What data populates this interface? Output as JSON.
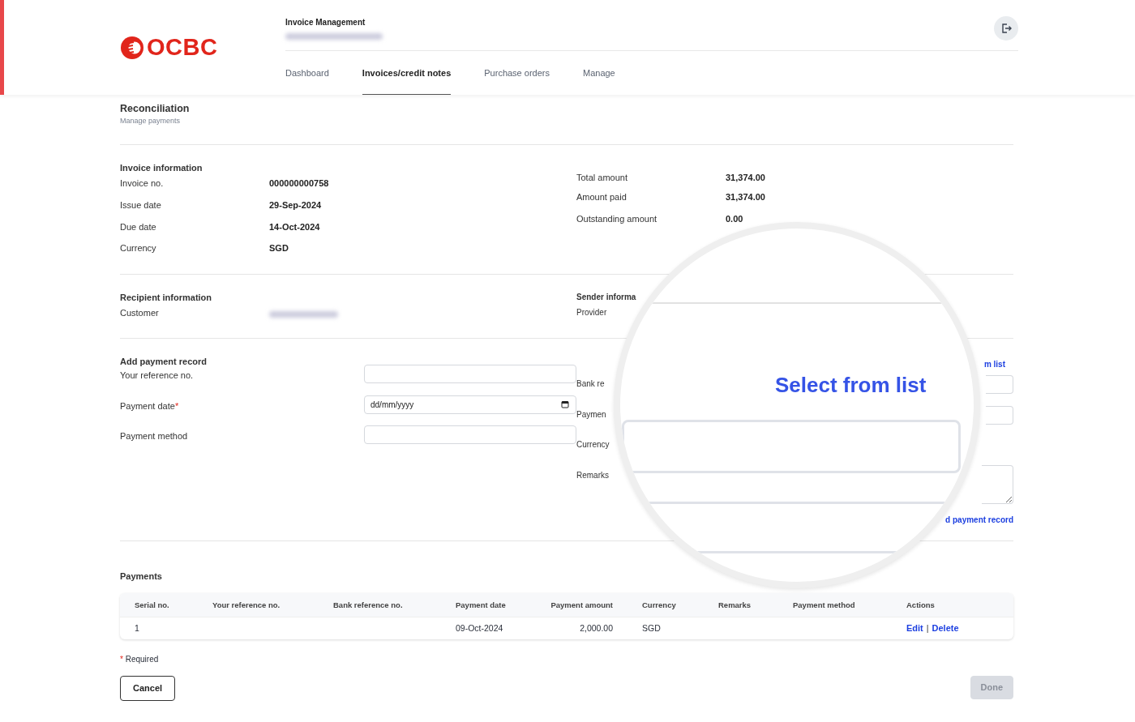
{
  "header": {
    "logo_text": "OCBC",
    "app_title": "Invoice Management",
    "tabs": [
      {
        "label": "Dashboard",
        "selected": false
      },
      {
        "label": "Invoices/credit notes",
        "selected": true
      },
      {
        "label": "Purchase orders",
        "selected": false
      },
      {
        "label": "Manage",
        "selected": false
      }
    ]
  },
  "page": {
    "title": "Reconciliation",
    "subtitle": "Manage payments"
  },
  "invoice_information": {
    "heading": "Invoice information",
    "fields": [
      {
        "label": "Invoice no.",
        "value": "000000000758"
      },
      {
        "label": "Issue date",
        "value": "29-Sep-2024"
      },
      {
        "label": "Due date",
        "value": "14-Oct-2024"
      },
      {
        "label": "Currency",
        "value": "SGD"
      }
    ],
    "amounts": [
      {
        "label": "Total amount",
        "value": "31,374.00"
      },
      {
        "label": "Amount paid",
        "value": "31,374.00"
      },
      {
        "label": "Outstanding amount",
        "value": "0.00"
      }
    ]
  },
  "recipient_information": {
    "heading": "Recipient information",
    "label": "Customer"
  },
  "sender_information": {
    "heading": "Sender informa",
    "label": "Provider"
  },
  "add_payment_record": {
    "heading": "Add payment record",
    "fields": [
      {
        "label": "Your reference no.",
        "required": false,
        "kind": "text"
      },
      {
        "label": "Payment date",
        "required": true,
        "kind": "date",
        "placeholder": "dd/mm/yyyy"
      },
      {
        "label": "Payment method",
        "required": false,
        "kind": "text"
      }
    ],
    "select_link": "m list",
    "right_fields": [
      {
        "label": "Bank re",
        "kind": "text"
      },
      {
        "label": "Paymen",
        "kind": "text"
      },
      {
        "label": "Currency",
        "kind": "none"
      },
      {
        "label": "Remarks",
        "kind": "textarea"
      }
    ],
    "add_link": "d payment record"
  },
  "magnifier": {
    "text": "Select from list"
  },
  "payments": {
    "heading": "Payments",
    "columns": [
      "Serial no.",
      "Your reference no.",
      "Bank reference no.",
      "Payment date",
      "Payment amount",
      "Currency",
      "Remarks",
      "Payment method",
      "Actions"
    ],
    "rows": [
      {
        "cells": [
          "1",
          null,
          null,
          "09-Oct-2024",
          "2,000.00",
          "SGD",
          null,
          null
        ],
        "actions": [
          "Edit",
          "Delete"
        ]
      }
    ],
    "action_separator": "|"
  },
  "required_note": {
    "mark": "*",
    "text": "Required"
  },
  "footer": {
    "buttons": [
      {
        "label": "Cancel",
        "disabled": false
      },
      {
        "label": "Done",
        "disabled": true
      }
    ]
  }
}
